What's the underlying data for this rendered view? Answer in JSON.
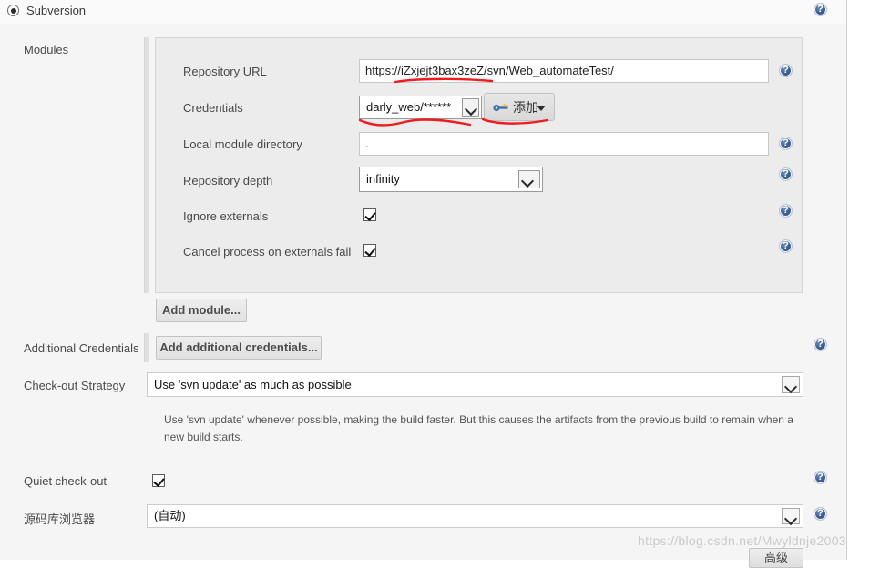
{
  "scm": {
    "selected_label": "Subversion",
    "radio_checked": true
  },
  "modules": {
    "section_label": "Modules",
    "add_module_button": "Add module...",
    "fields": {
      "repository_url": {
        "label": "Repository URL",
        "value": "https://iZxjejt3bax3zeZ/svn/Web_automateTest/"
      },
      "credentials": {
        "label": "Credentials",
        "value": "darly_web/******",
        "add_button": "添加"
      },
      "local_module_directory": {
        "label": "Local module directory",
        "value": "."
      },
      "repository_depth": {
        "label": "Repository depth",
        "value": "infinity"
      },
      "ignore_externals": {
        "label": "Ignore externals",
        "checked": true
      },
      "cancel_process_on_externals_fail": {
        "label": "Cancel process on externals fail",
        "checked": true
      }
    }
  },
  "additional_credentials": {
    "label": "Additional Credentials",
    "button": "Add additional credentials..."
  },
  "checkout_strategy": {
    "label": "Check-out Strategy",
    "value": "Use 'svn update' as much as possible",
    "description": "Use 'svn update' whenever possible, making the build faster. But this causes the artifacts from the previous build to remain when a new build starts."
  },
  "quiet_checkout": {
    "label": "Quiet check-out",
    "checked": true
  },
  "repository_browser": {
    "label": "源码库浏览器",
    "value": "(自动)"
  },
  "advanced_button": {
    "label": "高级"
  },
  "watermark": {
    "text": "https://blog.csdn.net/Mwyldnje2003"
  },
  "colors": {
    "help_icon": "#3f6298",
    "annotation": "#ee1c1c",
    "panel_bg": "#ececec",
    "page_bg": "#f5f5f5"
  },
  "icons": {
    "help": "help-icon",
    "key": "key-icon",
    "caret": "chevron-down-icon"
  }
}
